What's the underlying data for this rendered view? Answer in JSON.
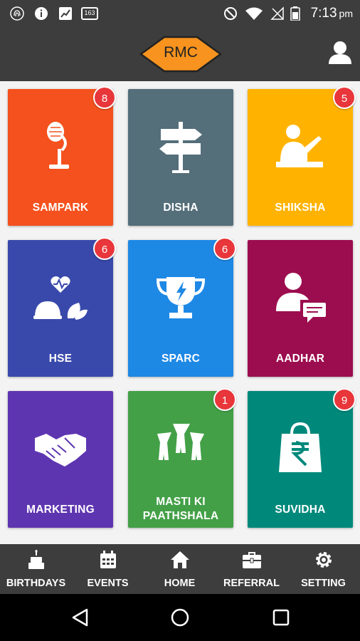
{
  "status_bar": {
    "time": "7:13",
    "time_suffix": "pm",
    "notification_badge": "163"
  },
  "header": {
    "logo_text": "RMC",
    "logo_color": "#f7931e"
  },
  "tiles": [
    {
      "label": "SAMPARK",
      "badge": "8",
      "color": "#f4511e",
      "icon": "microphone-icon"
    },
    {
      "label": "DISHA",
      "badge": "",
      "color": "#546e7a",
      "icon": "signpost-icon"
    },
    {
      "label": "SHIKSHA",
      "badge": "5",
      "color": "#ffb300",
      "icon": "teacher-icon"
    },
    {
      "label": "HSE",
      "badge": "6",
      "color": "#3949ab",
      "icon": "health-safety-icon"
    },
    {
      "label": "SPARC",
      "badge": "6",
      "color": "#1e88e5",
      "icon": "trophy-icon"
    },
    {
      "label": "AADHAR",
      "badge": "",
      "color": "#9c0d4f",
      "icon": "user-chat-icon"
    },
    {
      "label": "MARKETING",
      "badge": "",
      "color": "#5e35b1",
      "icon": "handshake-icon"
    },
    {
      "label_line1": "MASTI KI",
      "label_line2": "PAATHSHALA",
      "badge": "1",
      "color": "#43a047",
      "icon": "cheering-people-icon"
    },
    {
      "label": "SUVIDHA",
      "badge": "9",
      "color": "#00897b",
      "icon": "shopping-bag-rupee-icon"
    }
  ],
  "bottom_nav": [
    {
      "label": "BIRTHDAYS",
      "icon": "cake-icon"
    },
    {
      "label": "EVENTS",
      "icon": "calendar-icon"
    },
    {
      "label": "HOME",
      "icon": "home-icon"
    },
    {
      "label": "REFERRAL",
      "icon": "briefcase-icon"
    },
    {
      "label": "SETTING",
      "icon": "gear-icon"
    }
  ]
}
